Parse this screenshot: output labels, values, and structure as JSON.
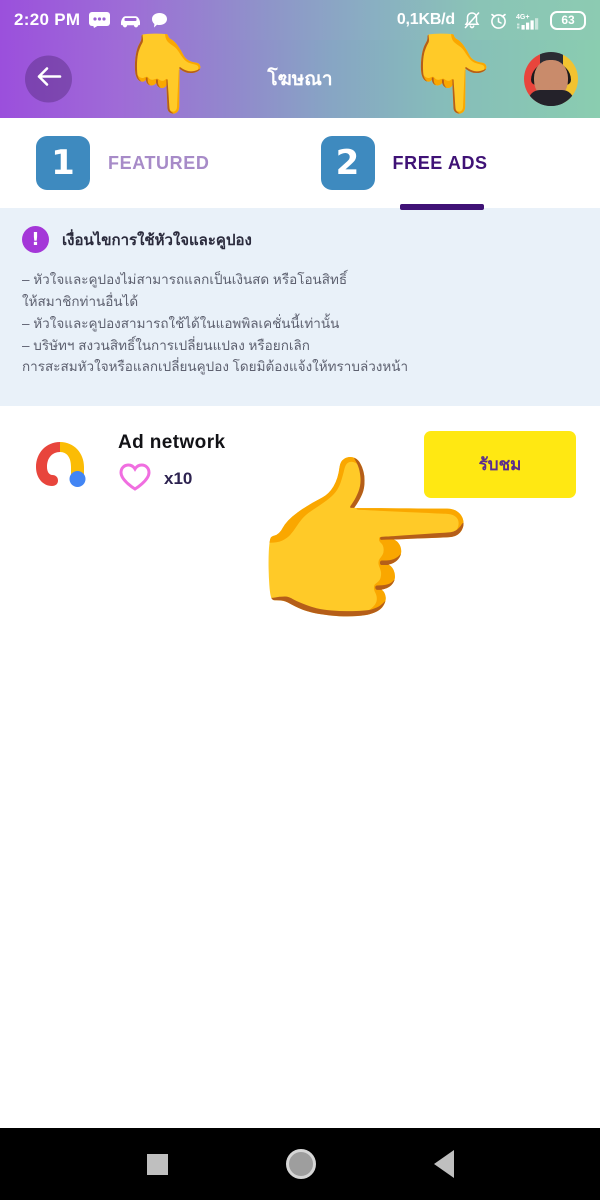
{
  "statusbar": {
    "time": "2:20 PM",
    "left_icons": [
      "message-icon",
      "car-icon",
      "chat-bubble-icon"
    ],
    "network_speed": "0,1KB/d",
    "right_icons": [
      "bell-muted-icon",
      "alarm-clock-icon",
      "signal-4g-plus-icon"
    ],
    "signal_label": "4G+",
    "battery_level": "63"
  },
  "header": {
    "title": "โฆษณา",
    "back_icon": "arrow-left-icon",
    "avatar": "user-avatar",
    "gradient_start": "#9B4FDC",
    "gradient_end": "#8ACDB0"
  },
  "tabs": [
    {
      "number": "1",
      "label": "FEATURED",
      "active": false
    },
    {
      "number": "2",
      "label": "FREE ADS",
      "active": true
    }
  ],
  "tab_colors": {
    "badge": "#3E8ABF",
    "active_text": "#3F1276",
    "inactive_text": "#A78BC8",
    "underline": "#3F1276"
  },
  "banner": {
    "icon": "exclamation-circle-icon",
    "icon_color": "#A437D8",
    "background": "#E9F1F9",
    "title": "เงื่อนไขการใช้หัวใจและคูปอง",
    "lines": [
      "– หัวใจและคูปองไม่สามารถแลกเป็นเงินสด หรือโอนสิทธิ์",
      "ให้สมาชิกท่านอื่นได้",
      "– หัวใจและคูปองสามารถใช้ได้ในแอพพิลเคชั่นนี้เท่านั้น",
      "– บริษัทฯ สงวนสิทธิ์ในการเปลี่ยนแปลง หรือยกเลิก",
      "การสะสมหัวใจหรือแลกเปลี่ยนคูปอง โดยมิต้องแจ้งให้ทราบล่วงหน้า"
    ]
  },
  "ad_item": {
    "logo": "applovin-logo",
    "name": "Ad network",
    "heart_icon": "heart-outline-icon",
    "heart_color": "#F06EE0",
    "reward": "x10",
    "button_label": "รับชม",
    "button_bg": "#FFE812",
    "button_text_color": "#5B2D8E"
  },
  "overlays": [
    {
      "icon": "hand-pointing-down-emoji",
      "glyph": "👇"
    },
    {
      "icon": "hand-pointing-down-emoji",
      "glyph": "👇"
    },
    {
      "icon": "hand-pointing-right-emoji",
      "glyph": "👉"
    }
  ],
  "navbar": {
    "recents": "square-recents-icon",
    "home": "circle-home-icon",
    "back": "triangle-back-icon"
  }
}
